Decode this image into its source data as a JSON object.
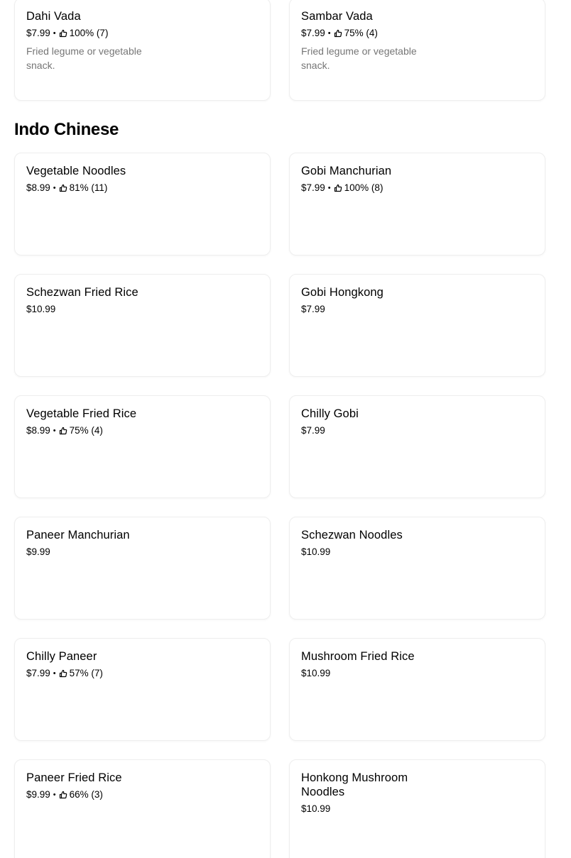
{
  "top_items": [
    {
      "name": "Dahi Vada",
      "price": "$7.99",
      "rating": "100% (7)",
      "description": "Fried legume or vegetable snack."
    },
    {
      "name": "Sambar Vada",
      "price": "$7.99",
      "rating": "75% (4)",
      "description": "Fried legume or vegetable snack."
    }
  ],
  "section": {
    "title": "Indo Chinese"
  },
  "items": [
    {
      "name": "Vegetable Noodles",
      "price": "$8.99",
      "rating": "81% (11)"
    },
    {
      "name": "Gobi Manchurian",
      "price": "$7.99",
      "rating": "100% (8)"
    },
    {
      "name": "Schezwan Fried Rice",
      "price": "$10.99"
    },
    {
      "name": "Gobi Hongkong",
      "price": "$7.99"
    },
    {
      "name": "Vegetable Fried Rice",
      "price": "$8.99",
      "rating": "75% (4)"
    },
    {
      "name": "Chilly Gobi",
      "price": "$7.99"
    },
    {
      "name": "Paneer Manchurian",
      "price": "$9.99"
    },
    {
      "name": "Schezwan Noodles",
      "price": "$10.99"
    },
    {
      "name": "Chilly Paneer",
      "price": "$7.99",
      "rating": "57% (7)"
    },
    {
      "name": "Mushroom Fried Rice",
      "price": "$10.99"
    },
    {
      "name": "Paneer Fried Rice",
      "price": "$9.99",
      "rating": "66% (3)"
    },
    {
      "name": "Honkong Mushroom Noodles",
      "price": "$10.99"
    }
  ],
  "separator": "•",
  "icons": {
    "rating": "thumbs-up-icon"
  }
}
